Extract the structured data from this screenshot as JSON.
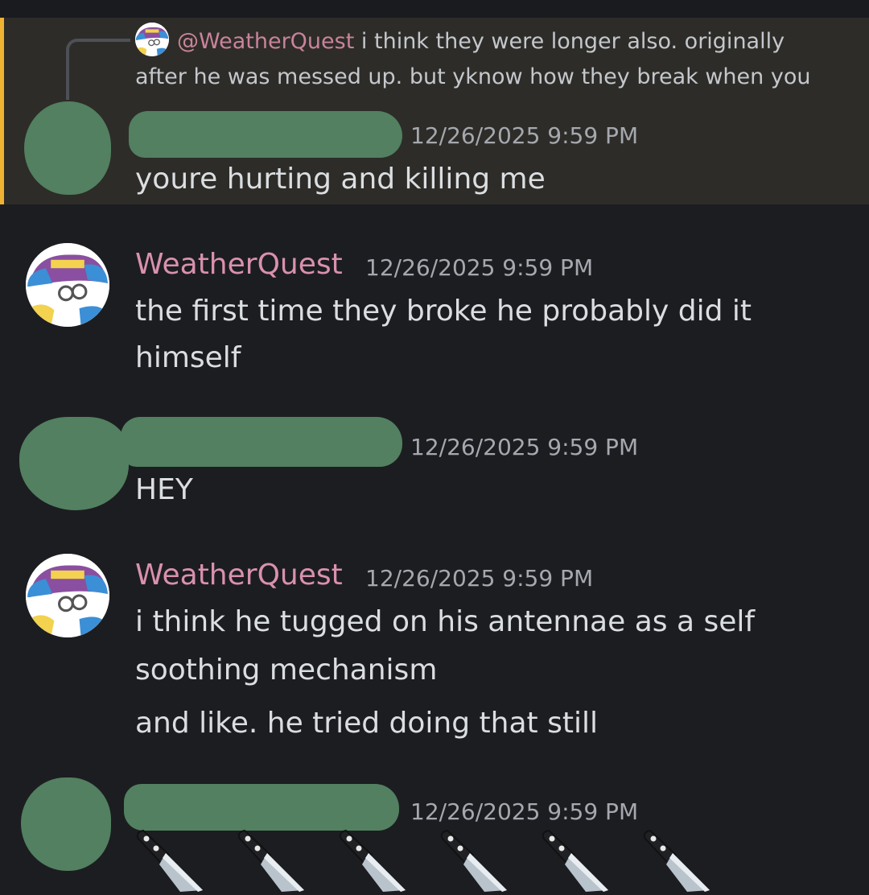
{
  "reply": {
    "mention": "@WeatherQuest",
    "preview": "i think they were longer also. originally after he was messed up. but yknow how they break when you"
  },
  "messages": [
    {
      "author_redacted": true,
      "timestamp": "12/26/2025 9:59 PM",
      "lines": [
        "youre hurting and killing me"
      ],
      "highlighted": true
    },
    {
      "author": "WeatherQuest",
      "timestamp": "12/26/2025 9:59 PM",
      "lines": [
        "the first time they broke he probably did it",
        "himself"
      ]
    },
    {
      "author_redacted": true,
      "timestamp": "12/26/2025 9:59 PM",
      "lines": [
        "HEY"
      ]
    },
    {
      "author": "WeatherQuest",
      "timestamp": "12/26/2025 9:59 PM",
      "lines": [
        "i think he tugged on his antennae as a self",
        "soothing mechanism",
        "and like. he tried doing that still"
      ]
    },
    {
      "author_redacted": true,
      "timestamp": "12/26/2025 9:59 PM",
      "emojis": [
        "knife-icon",
        "knife-icon",
        "knife-icon",
        "knife-icon",
        "knife-icon",
        "knife-icon"
      ]
    }
  ],
  "colors": {
    "background": "#1c1d21",
    "highlight_background": "#2d2c28",
    "highlight_bar": "#f0b232",
    "username": "#d991ad",
    "redaction": "#528060"
  }
}
